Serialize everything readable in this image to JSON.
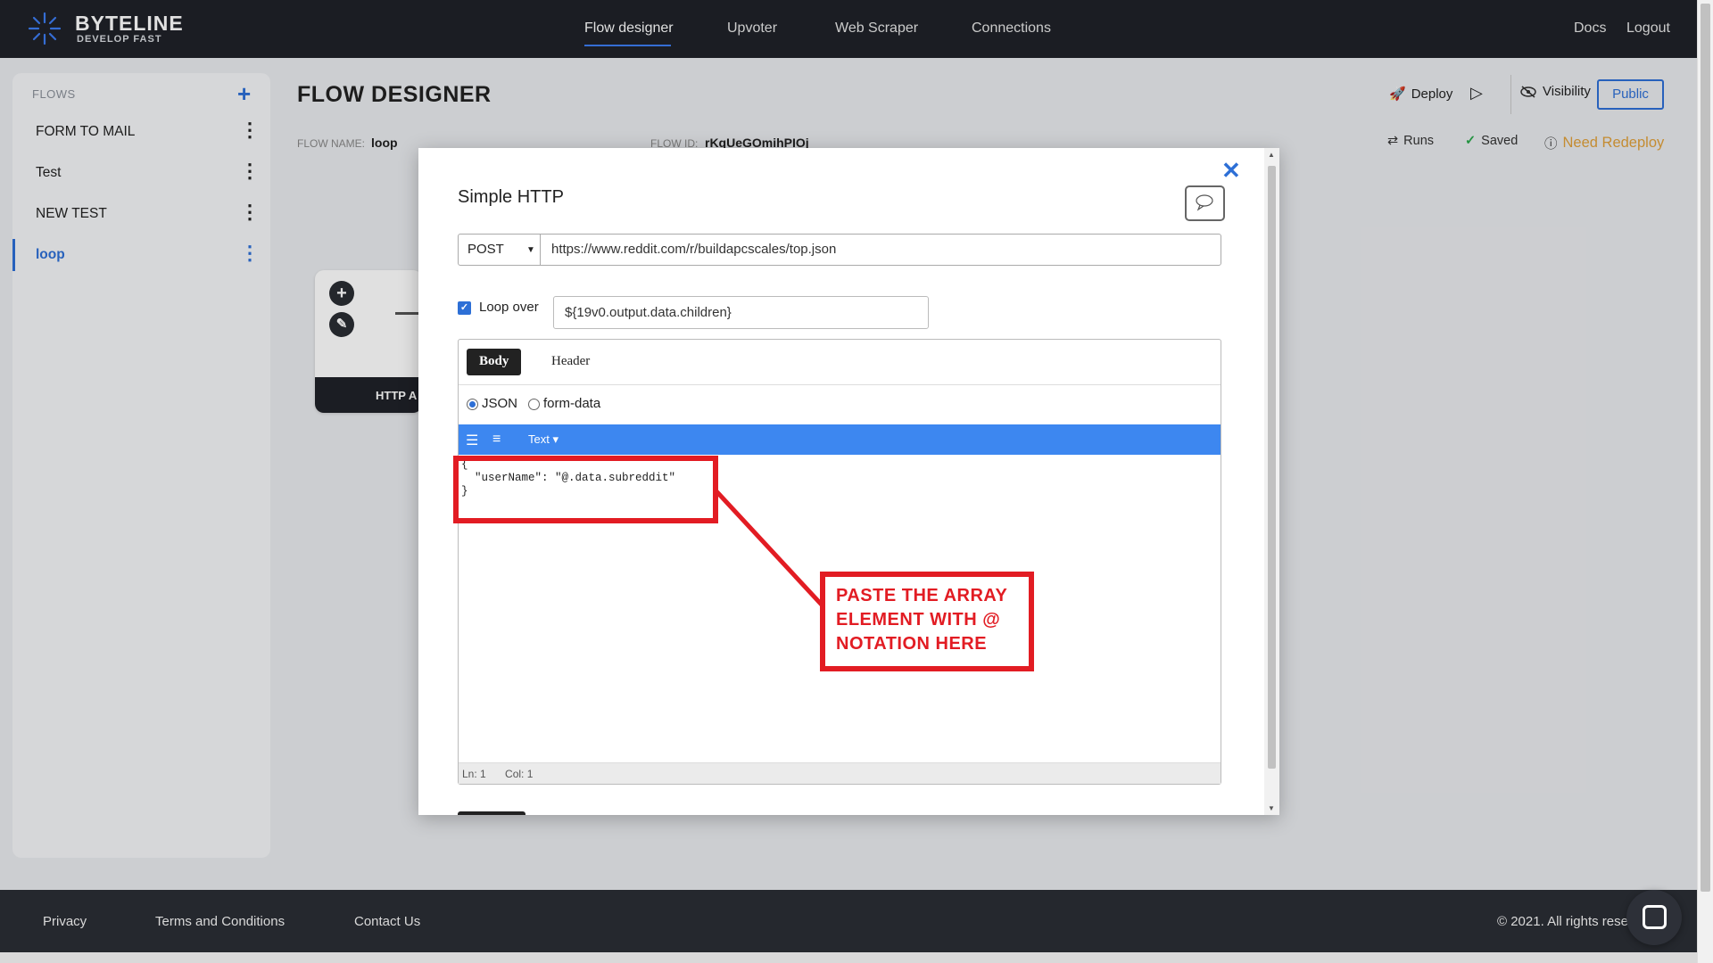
{
  "brand": {
    "name": "BYTELINE",
    "tagline": "DEVELOP FAST"
  },
  "nav": {
    "items": [
      {
        "label": "Flow designer",
        "active": true
      },
      {
        "label": "Upvoter"
      },
      {
        "label": "Web Scraper"
      },
      {
        "label": "Connections"
      }
    ],
    "right": [
      {
        "label": "Docs"
      },
      {
        "label": "Logout"
      }
    ]
  },
  "sidebar": {
    "heading": "FLOWS",
    "add_icon": "plus-icon",
    "items": [
      {
        "label": "FORM TO MAIL"
      },
      {
        "label": "Test"
      },
      {
        "label": "NEW TEST"
      },
      {
        "label": "loop",
        "active": true
      }
    ]
  },
  "header": {
    "title": "FLOW DESIGNER",
    "flow_name_label": "FLOW NAME:",
    "flow_name": "loop",
    "flow_id_label": "FLOW ID:",
    "flow_id": "rKqUeGOmihPIOj",
    "deploy_label": "Deploy",
    "visibility_label": "Visibility",
    "public_label": "Public",
    "runs_label": "Runs",
    "saved_label": "Saved",
    "need_redeploy_label": "Need Redeploy"
  },
  "canvas": {
    "node_label": "HTTP A"
  },
  "modal": {
    "title": "Simple HTTP",
    "method": "POST",
    "url": "https://www.reddit.com/r/buildapcscales/top.json",
    "loop_label": "Loop over",
    "loop_checked": true,
    "loop_value": "${19v0.output.data.children}",
    "tabs": [
      {
        "label": "Body",
        "active": true
      },
      {
        "label": "Header"
      }
    ],
    "body_types": [
      {
        "label": "JSON",
        "selected": true
      },
      {
        "label": "form-data"
      }
    ],
    "editor": {
      "mode_label": "Text ▾",
      "content": "{\n  \"userName\": \"@.data.subreddit\"\n}",
      "status_line": "Ln: 1",
      "status_col": "Col: 1"
    }
  },
  "annotation": {
    "text": "PASTE THE ARRAY ELEMENT WITH @ NOTATION HERE",
    "color": "#e21c23"
  },
  "footer": {
    "links": [
      {
        "label": "Privacy"
      },
      {
        "label": "Terms and Conditions"
      },
      {
        "label": "Contact Us"
      }
    ],
    "copyright": "© 2021. All rights rese"
  },
  "colors": {
    "accent": "#2d6fd6",
    "nav_bg": "#1f2228",
    "toolbar_blue": "#3d87f0",
    "warning": "#e0a03a"
  }
}
